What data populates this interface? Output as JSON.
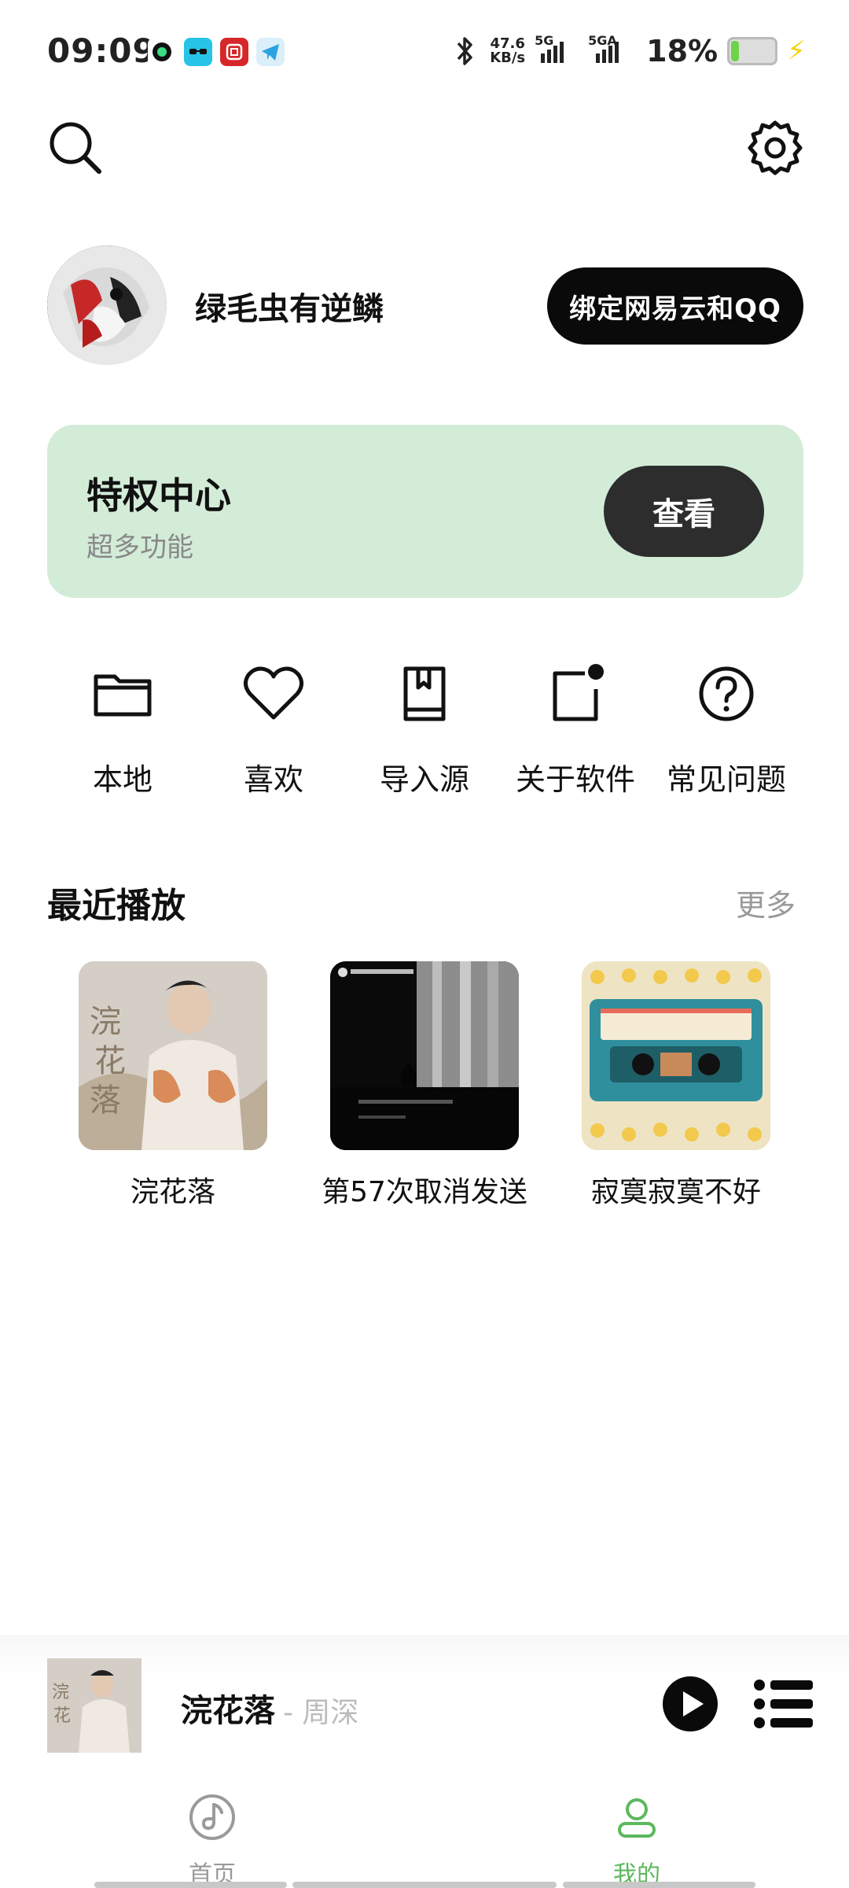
{
  "status_bar": {
    "time": "09:09",
    "net_speed_value": "47.6",
    "net_speed_unit": "KB/s",
    "sim1_label": "5G",
    "sim2_label": "5GA",
    "battery_percent": "18%",
    "battery_level": 0.18,
    "app_icons": [
      "chat-app-icon",
      "magic-app-icon",
      "bank-app-icon",
      "telegram-icon"
    ]
  },
  "profile": {
    "username": "绿毛虫有逆鳞",
    "bind_label": "绑定网易云和QQ"
  },
  "privilege": {
    "title": "特权中心",
    "subtitle": "超多功能",
    "button_label": "查看"
  },
  "quick_actions": [
    {
      "label": "本地",
      "icon": "folder-icon"
    },
    {
      "label": "喜欢",
      "icon": "heart-icon"
    },
    {
      "label": "导入源",
      "icon": "book-icon"
    },
    {
      "label": "关于软件",
      "icon": "info-note-icon"
    },
    {
      "label": "常见问题",
      "icon": "question-icon"
    }
  ],
  "recent": {
    "title": "最近播放",
    "more_label": "更多",
    "items": [
      {
        "title": "浣花落"
      },
      {
        "title": "第57次取消发送"
      },
      {
        "title": "寂寞寂寞不好"
      }
    ]
  },
  "player": {
    "title": "浣花落",
    "artist": "- 周深"
  },
  "nav": {
    "home_label": "首页",
    "mine_label": "我的",
    "active_color": "#5cb85c",
    "inactive_color": "#9a9a9a"
  },
  "colors": {
    "card_bg": "#d3ecd8",
    "dark_button": "#0a0a0a"
  }
}
